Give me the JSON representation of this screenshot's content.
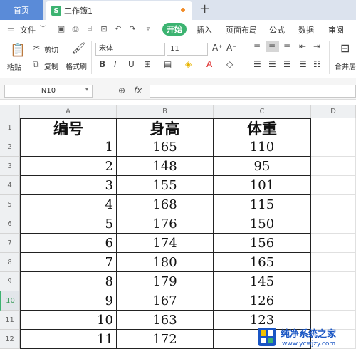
{
  "tabs": {
    "home": "首页",
    "document": "工作簿1",
    "doc_icon": "S",
    "new_tab": "+"
  },
  "menu": {
    "file": "文件",
    "items": [
      "开始",
      "插入",
      "页面布局",
      "公式",
      "数据",
      "审阅"
    ]
  },
  "ribbon": {
    "paste": "粘贴",
    "cut": "剪切",
    "copy": "复制",
    "format_painter": "格式刷",
    "font_name": "宋体",
    "font_size": "11",
    "merge_center": "合并居"
  },
  "formula_bar": {
    "name_box": "N10",
    "fx": "fx",
    "formula": ""
  },
  "columns": [
    "A",
    "B",
    "C",
    "D"
  ],
  "rows": [
    "1",
    "2",
    "3",
    "4",
    "5",
    "6",
    "7",
    "8",
    "9",
    "10",
    "11",
    "12"
  ],
  "active_row": "10",
  "table": {
    "headers": [
      "编号",
      "身高",
      "体重"
    ],
    "data": [
      [
        "1",
        "165",
        "110"
      ],
      [
        "2",
        "148",
        "95"
      ],
      [
        "3",
        "155",
        "101"
      ],
      [
        "4",
        "168",
        "115"
      ],
      [
        "5",
        "176",
        "150"
      ],
      [
        "6",
        "174",
        "156"
      ],
      [
        "7",
        "180",
        "165"
      ],
      [
        "8",
        "179",
        "145"
      ],
      [
        "9",
        "167",
        "126"
      ],
      [
        "10",
        "163",
        "123"
      ],
      [
        "11",
        "172",
        ""
      ]
    ]
  },
  "watermark": {
    "title": "纯净系统之家",
    "url": "www.ycwjzy.com"
  },
  "colors": {
    "accent": "#3cb371",
    "home_tab": "#5a8bd8",
    "watermark": "#1a56c4"
  }
}
